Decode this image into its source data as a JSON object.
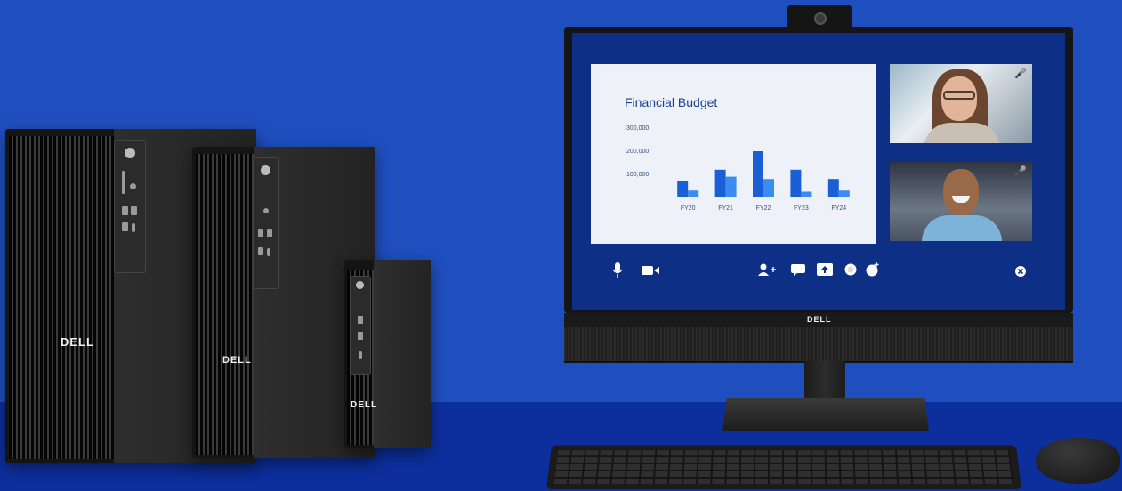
{
  "scene": {
    "background_color": "#1f4fbf",
    "floor_color": "#0d2f9e",
    "brand_logo_text": "DELL"
  },
  "presentation": {
    "title": "Financial Budget",
    "chart_data": {
      "type": "bar",
      "title": "Financial Budget",
      "categories": [
        "FY20",
        "FY21",
        "FY22",
        "FY23",
        "FY24"
      ],
      "y_ticks": [
        "300,000",
        "200,000",
        "100,000"
      ],
      "ylim": [
        0,
        300000
      ],
      "series": [
        {
          "values": [
            70000,
            120000,
            200000,
            120000,
            80000
          ],
          "color": "#1a5fd6"
        },
        {
          "values": [
            30000,
            90000,
            80000,
            25000,
            30000
          ],
          "color": "#3b8cf0"
        }
      ]
    }
  },
  "video_participants": [
    {
      "muted_icon": "mic-muted-icon"
    },
    {
      "muted_icon": "mic-muted-icon"
    }
  ],
  "call_controls": {
    "left": [
      "microphone-icon",
      "camera-icon"
    ],
    "center": [
      "add-person-icon",
      "chat-icon",
      "share-screen-icon",
      "record-icon",
      "reactions-icon"
    ],
    "right": [
      "close-call-icon"
    ]
  }
}
